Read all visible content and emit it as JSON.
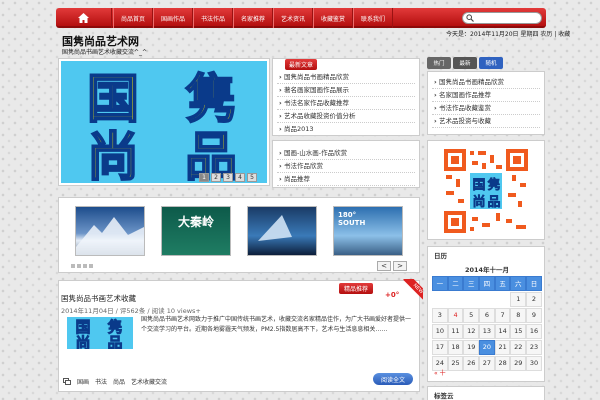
{
  "nav": {
    "items": [
      "尚品首页",
      "国画作品",
      "书法作品",
      "名家推荐",
      "艺术资讯",
      "收藏鉴赏",
      "联系我们"
    ]
  },
  "site": {
    "title": "国隽尚品艺术网",
    "subtitle": "国隽尚品书画艺术收藏交流^_^",
    "date_line": "今天是：2014年11月20日 星期四 农历 | 收藏"
  },
  "slider": {
    "pages": [
      "1",
      "2",
      "3",
      "4",
      "5"
    ],
    "logo_chars": [
      "国",
      "隽",
      "尚",
      "品"
    ]
  },
  "news_box": {
    "tab": "最新文章",
    "items": [
      "国隽尚品书画精品欣赏",
      "著名画家国画作品展示",
      "书法名家作品收藏推荐",
      "艺术品收藏投资价值分析",
      "尚品2013"
    ]
  },
  "links_box": {
    "items": [
      "国画-山水画-作品欣赏",
      "书法作品欣赏",
      "尚品推荐"
    ]
  },
  "thumbs": {
    "labels": [
      "",
      "大秦岭",
      "",
      "180° SOUTH"
    ],
    "prev": "<",
    "next": ">"
  },
  "post": {
    "tab": "精品推荐",
    "counter": "+0°",
    "new_badge": "NEW",
    "title": "国隽尚品书画艺术收藏",
    "meta": "2014年11月04日 / 评562条 / 阅读 10 views+",
    "body": "国隽尚品书画艺术网致力于推广中国传统书画艺术，收藏交流名家精品佳作，为广大书画爱好者提供一个交流学习的平台。近期各地雾霾天气频发，PM2.5指数居高不下，艺术与生活息息相关……",
    "read_more": "阅读全文",
    "tags": [
      "国画",
      "书法",
      "尚品",
      "艺术收藏交流"
    ]
  },
  "sidebar": {
    "tabs": [
      "热门",
      "最新",
      "随机"
    ],
    "list": [
      "国隽尚品书画精品欣赏",
      "名家国画作品推荐",
      "书法作品收藏鉴赏",
      "艺术品投资与收藏"
    ],
    "calendar_title": "日历",
    "calendar_month": "2014年十一月",
    "weekdays": [
      "一",
      "二",
      "三",
      "四",
      "五",
      "六",
      "日"
    ],
    "prev": "« 十",
    "tags_title": "标签云"
  },
  "colors": {
    "nav_red": "#c81e1e",
    "tab_gray": "#666666",
    "tab_blue": "#2f62c0",
    "logo_cyan": "#4fc8f0",
    "logo_yellow": "#f2e600",
    "today_blue": "#4a8fe0"
  }
}
